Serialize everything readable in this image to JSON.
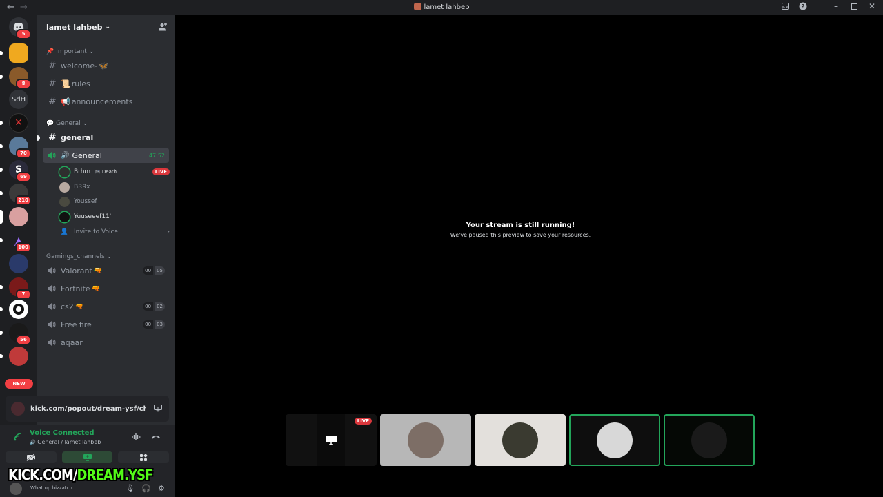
{
  "window": {
    "title": "lamet lahbeb"
  },
  "rail": {
    "badges": [
      "5",
      "8",
      "70",
      "69",
      "210",
      "100",
      "7",
      "56"
    ],
    "text_server": "SdH",
    "new_label": "NEW"
  },
  "guild": {
    "name": "lamet lahbeb"
  },
  "categories": {
    "important": "Important",
    "general": "General",
    "gaming": "Gamings_channels"
  },
  "channels": {
    "welcome": "welcome-",
    "rules": "rules",
    "announcements": "announcements",
    "general_text": "general",
    "general_voice": "General",
    "general_voice_time": "47:52",
    "valorant": "Valorant",
    "fortnite": "Fortnite",
    "cs2": "cs2",
    "freefire": "Free fire",
    "aqaar": "aqaar"
  },
  "channel_counts": {
    "valorant": [
      "00",
      "05"
    ],
    "cs2": [
      "00",
      "02"
    ],
    "freefire": [
      "00",
      "03"
    ]
  },
  "voice_users": [
    {
      "name": "Brhm",
      "activity": "Death",
      "live": "LIVE"
    },
    {
      "name": "BR9x"
    },
    {
      "name": "Youssef"
    },
    {
      "name": "Yuuseeef11'"
    }
  ],
  "invite_label": "Invite to Voice",
  "popout": {
    "text": "kick.com/popout/dream-ysf/chat..."
  },
  "voice_panel": {
    "status": "Voice Connected",
    "location": "General / lamet lahbeb"
  },
  "user": {
    "status": "What up bizzatch"
  },
  "watermark": {
    "part1": "KICK.COM/",
    "part2": "DREAM.YSF"
  },
  "stage": {
    "headline": "Your stream is still running!",
    "subline": "We've paused this preview to save your resources."
  },
  "tiles": {
    "live_label": "LIVE"
  },
  "colors": {
    "accent_green": "#23a55a",
    "live_red": "#da373c",
    "kick_green": "#53fc18"
  }
}
